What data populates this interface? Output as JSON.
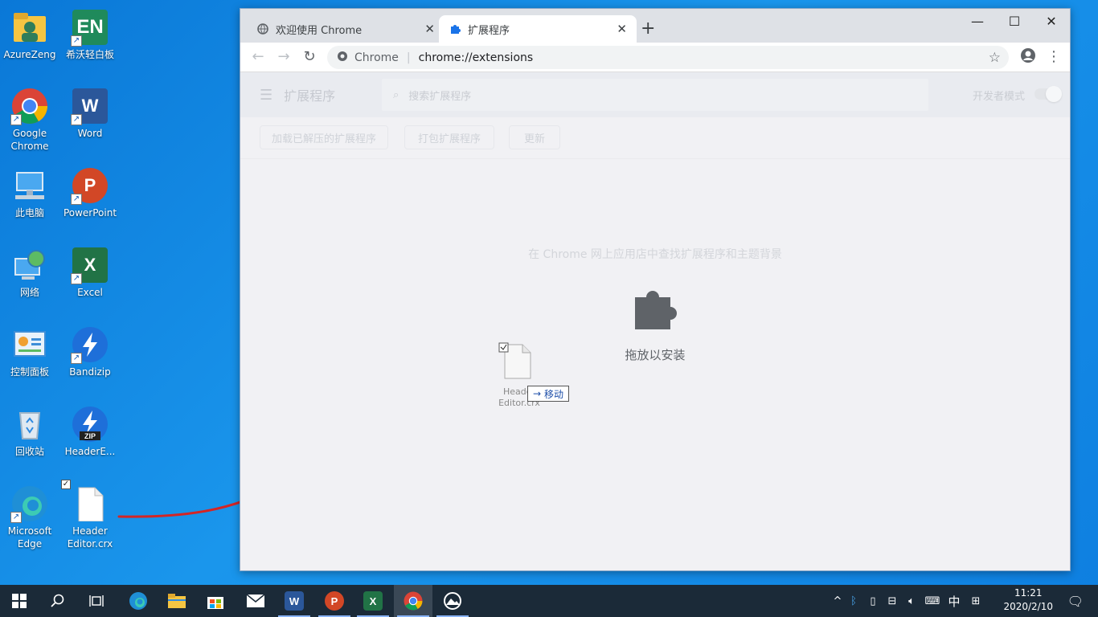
{
  "desktop": {
    "icons": [
      {
        "label": "AzureZeng"
      },
      {
        "label": "希沃轻白板"
      },
      {
        "label": "Google Chrome"
      },
      {
        "label": "Word"
      },
      {
        "label": "此电脑"
      },
      {
        "label": "PowerPoint"
      },
      {
        "label": "网络"
      },
      {
        "label": "Excel"
      },
      {
        "label": "控制面板"
      },
      {
        "label": "Bandizip"
      },
      {
        "label": "回收站"
      },
      {
        "label": "HeaderE..."
      },
      {
        "label": "Microsoft Edge"
      },
      {
        "label": "Header Editor.crx"
      }
    ]
  },
  "chrome": {
    "tabs": [
      {
        "label": "欢迎使用 Chrome",
        "icon": "globe-icon"
      },
      {
        "label": "扩展程序",
        "icon": "puzzle-icon"
      }
    ],
    "omnibox": {
      "site": "Chrome",
      "url": "chrome://extensions"
    },
    "extensions_page": {
      "title": "扩展程序",
      "search_placeholder": "搜索扩展程序",
      "dev_mode_label": "开发者模式",
      "buttons": [
        "加载已解压的扩展程序",
        "打包扩展程序",
        "更新"
      ],
      "store_link": "在 Chrome 网上应用店中查找扩展程序和主题背景",
      "drop_label": "拖放以安装"
    },
    "drag": {
      "file_label": "Header Editor.crx",
      "tooltip": "移动"
    }
  },
  "taskbar": {
    "ime": "中",
    "time": "11:21",
    "date": "2020/2/10"
  }
}
